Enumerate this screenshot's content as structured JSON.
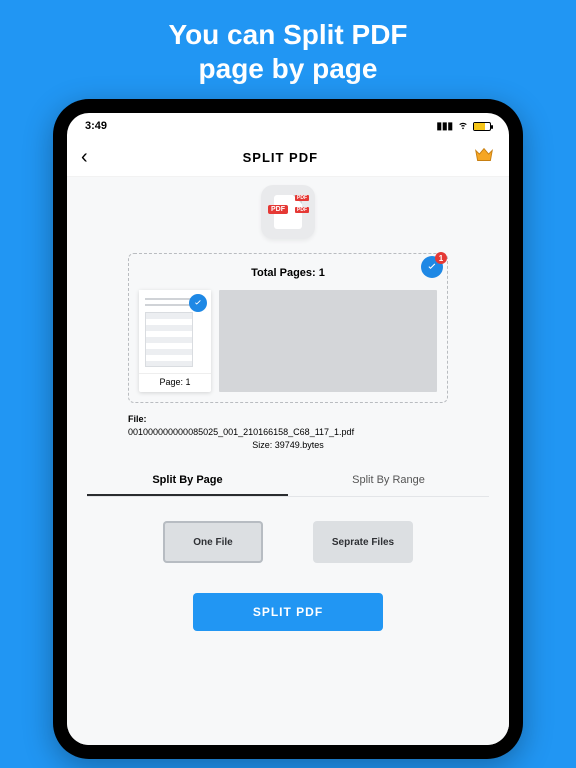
{
  "promo": {
    "line1": "You can Split PDF",
    "line2": "page by page"
  },
  "status": {
    "time": "3:49"
  },
  "nav": {
    "title": "SPLIT  PDF"
  },
  "selection": {
    "total_label": "Total Pages: 1",
    "badge": "1",
    "thumb_caption": "Page:  1"
  },
  "file": {
    "label": "File:",
    "name": "001000000000085025_001_210166158_C68_117_1.pdf",
    "size_label": "Size: 39749.bytes"
  },
  "tabs": {
    "by_page": "Split By Page",
    "by_range": "Split By Range"
  },
  "options": {
    "one_file": "One File",
    "separate": "Seprate Files"
  },
  "cta": {
    "split": "SPLIT  PDF"
  },
  "icons": {
    "pdf_tag": "PDF",
    "pdf_mini": "PDF"
  }
}
